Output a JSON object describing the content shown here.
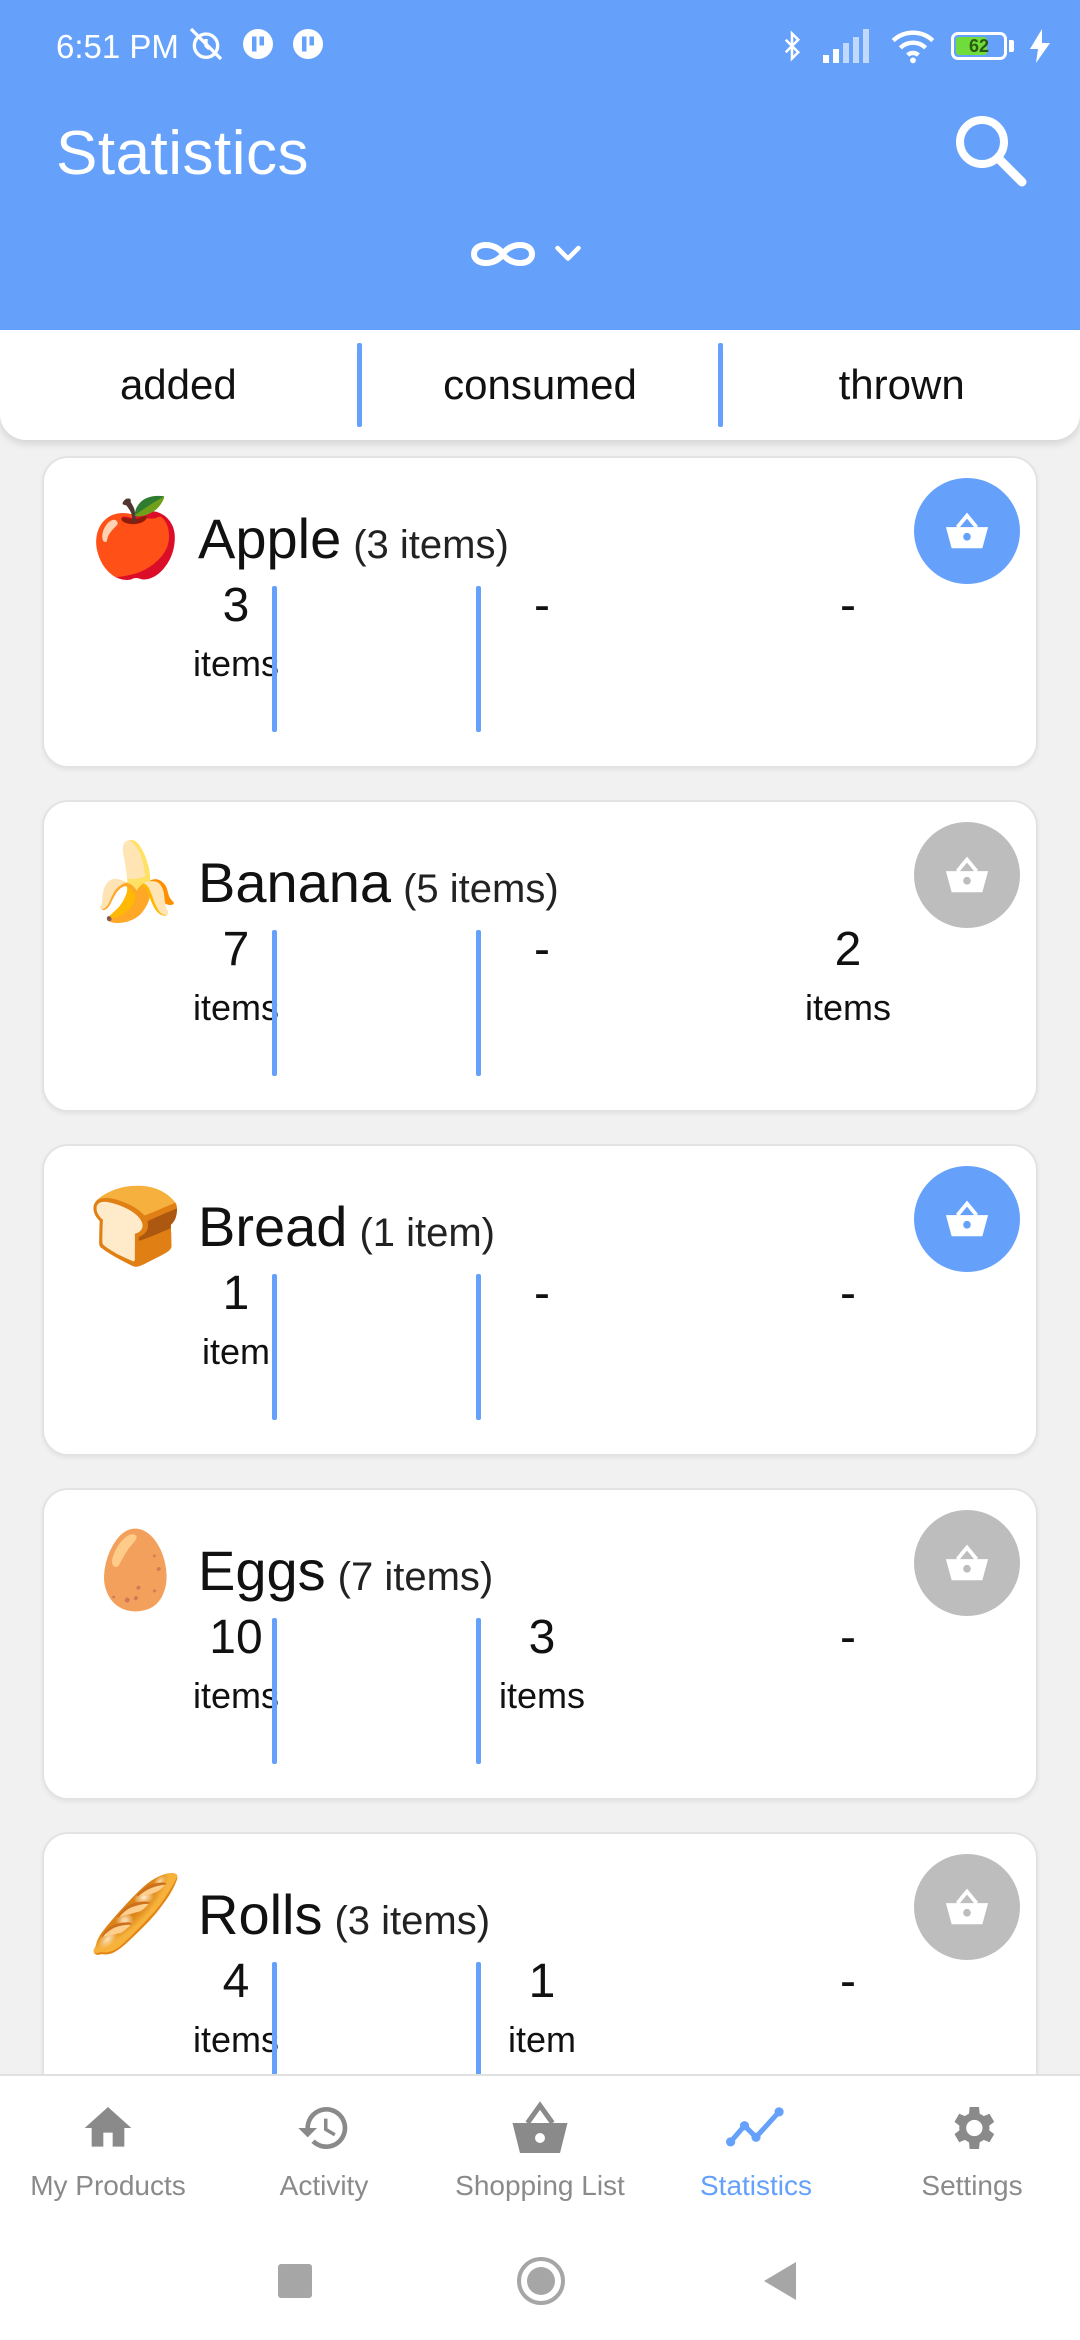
{
  "status_bar": {
    "time": "6:51 PM",
    "battery": "62",
    "icons": [
      "alarm-off-icon",
      "app-notification-icon",
      "app-notification-icon",
      "bluetooth-icon",
      "signal-icon",
      "wifi-icon",
      "battery-icon",
      "charging-icon"
    ]
  },
  "header": {
    "title": "Statistics",
    "period_icon": "infinity-icon",
    "search_icon": "search-icon"
  },
  "tabs": [
    "added",
    "consumed",
    "thrown"
  ],
  "products": [
    {
      "emoji": "🍎",
      "name": "Apple",
      "count": "(3 items)",
      "in_list": true,
      "added": {
        "num": "3",
        "unit": "items"
      },
      "consumed": {
        "num": "-",
        "unit": ""
      },
      "thrown": {
        "num": "-",
        "unit": ""
      }
    },
    {
      "emoji": "🍌",
      "name": "Banana",
      "count": "(5 items)",
      "in_list": false,
      "added": {
        "num": "7",
        "unit": "items"
      },
      "consumed": {
        "num": "-",
        "unit": ""
      },
      "thrown": {
        "num": "2",
        "unit": "items"
      }
    },
    {
      "emoji": "🍞",
      "name": "Bread",
      "count": "(1 item)",
      "in_list": true,
      "added": {
        "num": "1",
        "unit": "item"
      },
      "consumed": {
        "num": "-",
        "unit": ""
      },
      "thrown": {
        "num": "-",
        "unit": ""
      }
    },
    {
      "emoji": "🥚",
      "name": "Eggs",
      "count": "(7 items)",
      "in_list": false,
      "added": {
        "num": "10",
        "unit": "items"
      },
      "consumed": {
        "num": "3",
        "unit": "items"
      },
      "thrown": {
        "num": "-",
        "unit": ""
      }
    },
    {
      "emoji": "🥖",
      "name": "Rolls",
      "count": "(3 items)",
      "in_list": false,
      "added": {
        "num": "4",
        "unit": "items"
      },
      "consumed": {
        "num": "1",
        "unit": "item"
      },
      "thrown": {
        "num": "-",
        "unit": ""
      }
    }
  ],
  "bottom_nav": [
    {
      "label": "My Products",
      "icon": "home-icon",
      "active": false
    },
    {
      "label": "Activity",
      "icon": "history-icon",
      "active": false
    },
    {
      "label": "Shopping List",
      "icon": "basket-icon",
      "active": false
    },
    {
      "label": "Statistics",
      "icon": "chart-icon",
      "active": true
    },
    {
      "label": "Settings",
      "icon": "settings-icon",
      "active": false
    }
  ],
  "colors": {
    "accent": "#65a1fb",
    "inactive_basket": "#bdbdbd",
    "nav_inactive": "#8a8a8a"
  }
}
